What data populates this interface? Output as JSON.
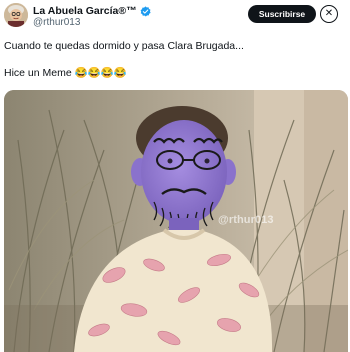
{
  "author": {
    "display_name": "La Abuela García®™",
    "handle": "@rthur013",
    "avatar_icon": "grandma-avatar-icon",
    "verified_icon": "verified-badge-icon",
    "verified_color": "#1d9bf0"
  },
  "actions": {
    "subscribe_label": "Suscribirse",
    "close_icon": "close-icon"
  },
  "tweet": {
    "line1": "Cuando te quedas dormido y pasa Clara Brugada...",
    "line2": "Hice un Meme 😂😂😂😂"
  },
  "media": {
    "watermark": "@rthur013"
  }
}
